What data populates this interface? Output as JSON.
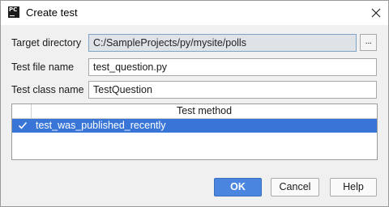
{
  "window": {
    "title": "Create test",
    "app_icon_text": "PC"
  },
  "form": {
    "target_directory": {
      "label": "Target directory",
      "value": "C:/SampleProjects/py/mysite/polls",
      "browse_label": "..."
    },
    "test_file_name": {
      "label": "Test file name",
      "value": "test_question.py"
    },
    "test_class_name": {
      "label": "Test class name",
      "value": "TestQuestion"
    }
  },
  "methods_table": {
    "column_header": "Test method",
    "rows": [
      {
        "checked": true,
        "name": "test_was_published_recently",
        "selected": true
      }
    ]
  },
  "buttons": {
    "ok": "OK",
    "cancel": "Cancel",
    "help": "Help"
  },
  "colors": {
    "selection": "#3875d7",
    "ok_button": "#4a86e0",
    "readonly_field": "#dfe3e8"
  }
}
